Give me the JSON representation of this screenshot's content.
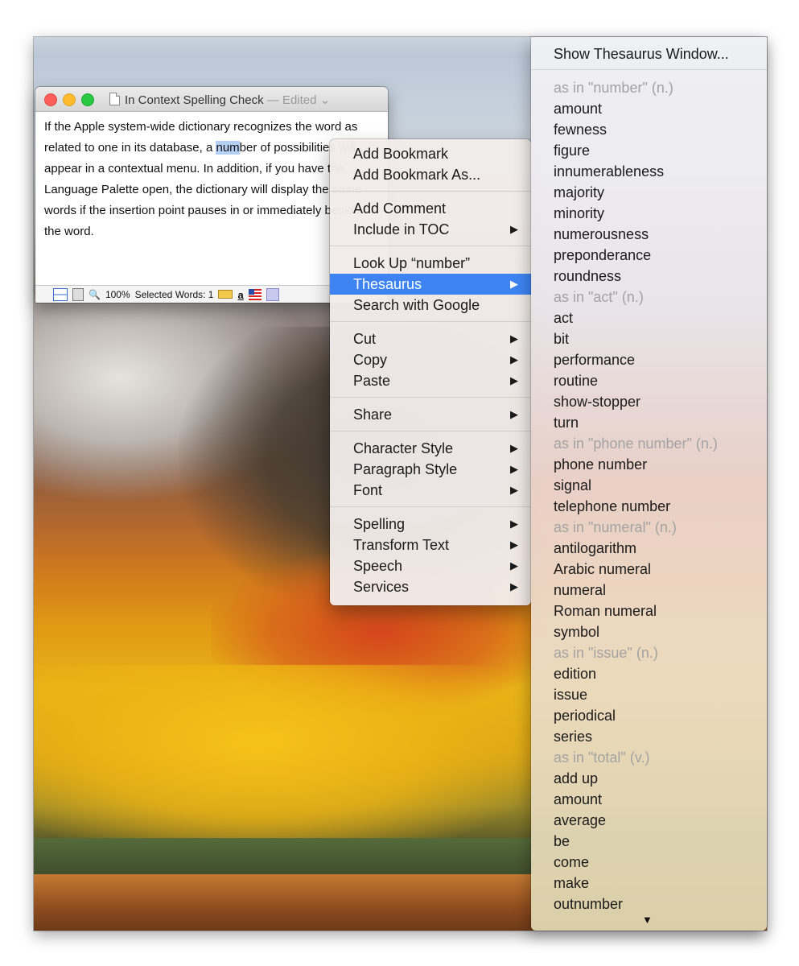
{
  "document": {
    "title": "In Context Spelling Check",
    "title_separator": " — ",
    "edited_label": "Edited",
    "body_before": "If the Apple system-wide dictionary recognizes the word as related to one in its database, a ",
    "body_selected": "num",
    "body_after": "ber of possibilities will appear in a contextual menu. In addition, if you have the Language Palette open, the dictionary will display the same words if the insertion point pauses in or immediately beside the word.",
    "status": {
      "zoom": "100%",
      "selected_words_label": "Selected Words: 1"
    }
  },
  "context_menu": {
    "groups": [
      [
        {
          "label": "Add Bookmark"
        },
        {
          "label": "Add Bookmark As..."
        }
      ],
      [
        {
          "label": "Add Comment"
        },
        {
          "label": "Include in TOC",
          "submenu": true
        }
      ],
      [
        {
          "label": "Look Up “number”"
        },
        {
          "label": "Thesaurus",
          "submenu": true,
          "selected": true
        },
        {
          "label": "Search with Google"
        }
      ],
      [
        {
          "label": "Cut",
          "submenu": true
        },
        {
          "label": "Copy",
          "submenu": true
        },
        {
          "label": "Paste",
          "submenu": true
        }
      ],
      [
        {
          "label": "Share",
          "submenu": true
        }
      ],
      [
        {
          "label": "Character Style",
          "submenu": true
        },
        {
          "label": "Paragraph Style",
          "submenu": true
        },
        {
          "label": "Font",
          "submenu": true
        }
      ],
      [
        {
          "label": "Spelling",
          "submenu": true
        },
        {
          "label": "Transform Text",
          "submenu": true
        },
        {
          "label": "Speech",
          "submenu": true
        },
        {
          "label": "Services",
          "submenu": true
        }
      ]
    ],
    "submenu_glyph": "▶"
  },
  "thesaurus_menu": {
    "show_window_label": "Show Thesaurus Window...",
    "items": [
      {
        "label": "as in \"number\" (n.)",
        "header": true
      },
      {
        "label": "amount"
      },
      {
        "label": "fewness"
      },
      {
        "label": "figure"
      },
      {
        "label": "innumerableness"
      },
      {
        "label": "majority"
      },
      {
        "label": "minority"
      },
      {
        "label": "numerousness"
      },
      {
        "label": "preponderance"
      },
      {
        "label": "roundness"
      },
      {
        "label": "as in \"act\" (n.)",
        "header": true
      },
      {
        "label": "act"
      },
      {
        "label": "bit"
      },
      {
        "label": "performance"
      },
      {
        "label": "routine"
      },
      {
        "label": "show-stopper"
      },
      {
        "label": "turn"
      },
      {
        "label": "as in \"phone number\" (n.)",
        "header": true
      },
      {
        "label": "phone number"
      },
      {
        "label": "signal"
      },
      {
        "label": "telephone number"
      },
      {
        "label": "as in \"numeral\" (n.)",
        "header": true
      },
      {
        "label": "antilogarithm"
      },
      {
        "label": "Arabic numeral"
      },
      {
        "label": "numeral"
      },
      {
        "label": "Roman numeral"
      },
      {
        "label": "symbol"
      },
      {
        "label": "as in \"issue\" (n.)",
        "header": true
      },
      {
        "label": "edition"
      },
      {
        "label": "issue"
      },
      {
        "label": "periodical"
      },
      {
        "label": "series"
      },
      {
        "label": "as in \"total\" (v.)",
        "header": true
      },
      {
        "label": "add up"
      },
      {
        "label": "amount"
      },
      {
        "label": "average"
      },
      {
        "label": "be"
      },
      {
        "label": "come"
      },
      {
        "label": "make"
      },
      {
        "label": "outnumber"
      }
    ],
    "scroll_more_glyph": "▼"
  }
}
